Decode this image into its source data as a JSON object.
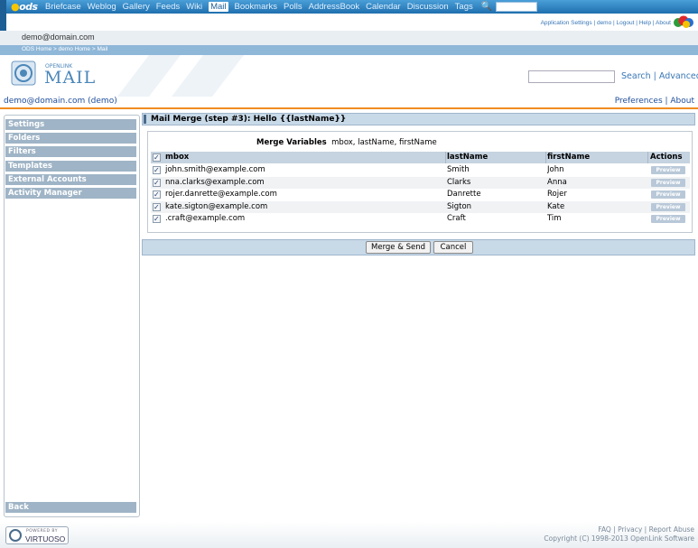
{
  "topnav": {
    "logo": "ods",
    "links": [
      "Briefcase",
      "Weblog",
      "Gallery",
      "Feeds",
      "Wiki",
      "Mail",
      "Bookmarks",
      "Polls",
      "AddressBook",
      "Calendar",
      "Discussion",
      "Tags"
    ],
    "active": "Mail",
    "search_icon": "search-icon"
  },
  "appline": {
    "links": "Application Settings | demo | Logout | Help | About"
  },
  "user_email": "demo@domain.com",
  "breadcrumb": "ODS Home > demo Home > Mail",
  "logo": {
    "brand": "OPENLINK",
    "product": "MAIL"
  },
  "search": {
    "value": "",
    "links": "Search | Advanced"
  },
  "account": {
    "user": "demo@domain.com (demo)",
    "links": "Preferences | About"
  },
  "sidebar": {
    "items": [
      "Settings",
      "Folders",
      "Filters",
      "Templates",
      "External Accounts",
      "Activity Manager"
    ],
    "back": "Back"
  },
  "main": {
    "title": "Mail Merge (step #3): Hello {{lastName}}",
    "merge_label": "Merge Variables",
    "merge_vars": "mbox, lastName, firstName",
    "columns": [
      "mbox",
      "lastName",
      "firstName",
      "Actions"
    ],
    "rows": [
      {
        "mbox": "john.smith@example.com",
        "lastName": "Smith",
        "firstName": "John",
        "action": "Preview",
        "checked": true
      },
      {
        "mbox": "nna.clarks@example.com",
        "lastName": "Clarks",
        "firstName": "Anna",
        "action": "Preview",
        "checked": true
      },
      {
        "mbox": "rojer.danrette@example.com",
        "lastName": "Danrette",
        "firstName": "Rojer",
        "action": "Preview",
        "checked": true
      },
      {
        "mbox": "kate.sigton@example.com",
        "lastName": "Sigton",
        "firstName": "Kate",
        "action": "Preview",
        "checked": true
      },
      {
        "mbox": ".craft@example.com",
        "lastName": "Craft",
        "firstName": "Tim",
        "action": "Preview",
        "checked": true
      }
    ],
    "buttons": {
      "merge": "Merge & Send",
      "cancel": "Cancel"
    }
  },
  "footer": {
    "powered": "POWERED BY",
    "virtuoso": "VIRTUOSO",
    "links": "FAQ | Privacy | Report Abuse",
    "copyright": "Copyright (C) 1998-2013 OpenLink Software"
  },
  "colors": {
    "nav": "#2a7fbf",
    "accent_rule": "#f08c20",
    "sidebar_item": "#9fb4c6",
    "link": "#3977b6"
  }
}
